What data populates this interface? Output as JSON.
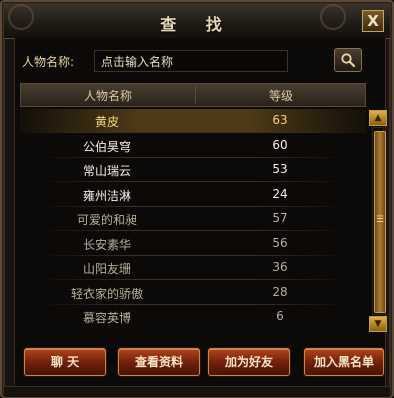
{
  "window": {
    "title": "查 找",
    "close_label": "X"
  },
  "search": {
    "label": "人物名称:",
    "value": "点击输入名称",
    "button_icon": "magnifier-icon"
  },
  "table": {
    "columns": [
      "人物名称",
      "等级"
    ],
    "rows": [
      {
        "name": "黄皮",
        "level": "63",
        "state": "selected"
      },
      {
        "name": "公伯昊穹",
        "level": "60",
        "state": "online"
      },
      {
        "name": "常山瑞云",
        "level": "53",
        "state": "online"
      },
      {
        "name": "雍州洁淋",
        "level": "24",
        "state": "online"
      },
      {
        "name": "可爱的和昶",
        "level": "57",
        "state": "normal"
      },
      {
        "name": "长安素华",
        "level": "56",
        "state": "normal"
      },
      {
        "name": "山阳友珊",
        "level": "36",
        "state": "normal"
      },
      {
        "name": "轻衣家的骄傲",
        "level": "28",
        "state": "normal"
      },
      {
        "name": "慕容英博",
        "level": "6",
        "state": "normal"
      }
    ]
  },
  "scrollbar": {
    "up_label": "▲",
    "down_label": "▼",
    "grip_label": "☰"
  },
  "buttons": {
    "chat": "聊 天",
    "view_profile": "查看资料",
    "add_friend": "加为好友",
    "add_blacklist": "加入黑名单"
  },
  "colors": {
    "selected_text": "#f3d77a",
    "online_text": "#f4f0e6",
    "normal_text": "#b8ad98",
    "button_red": "#8a2810"
  }
}
